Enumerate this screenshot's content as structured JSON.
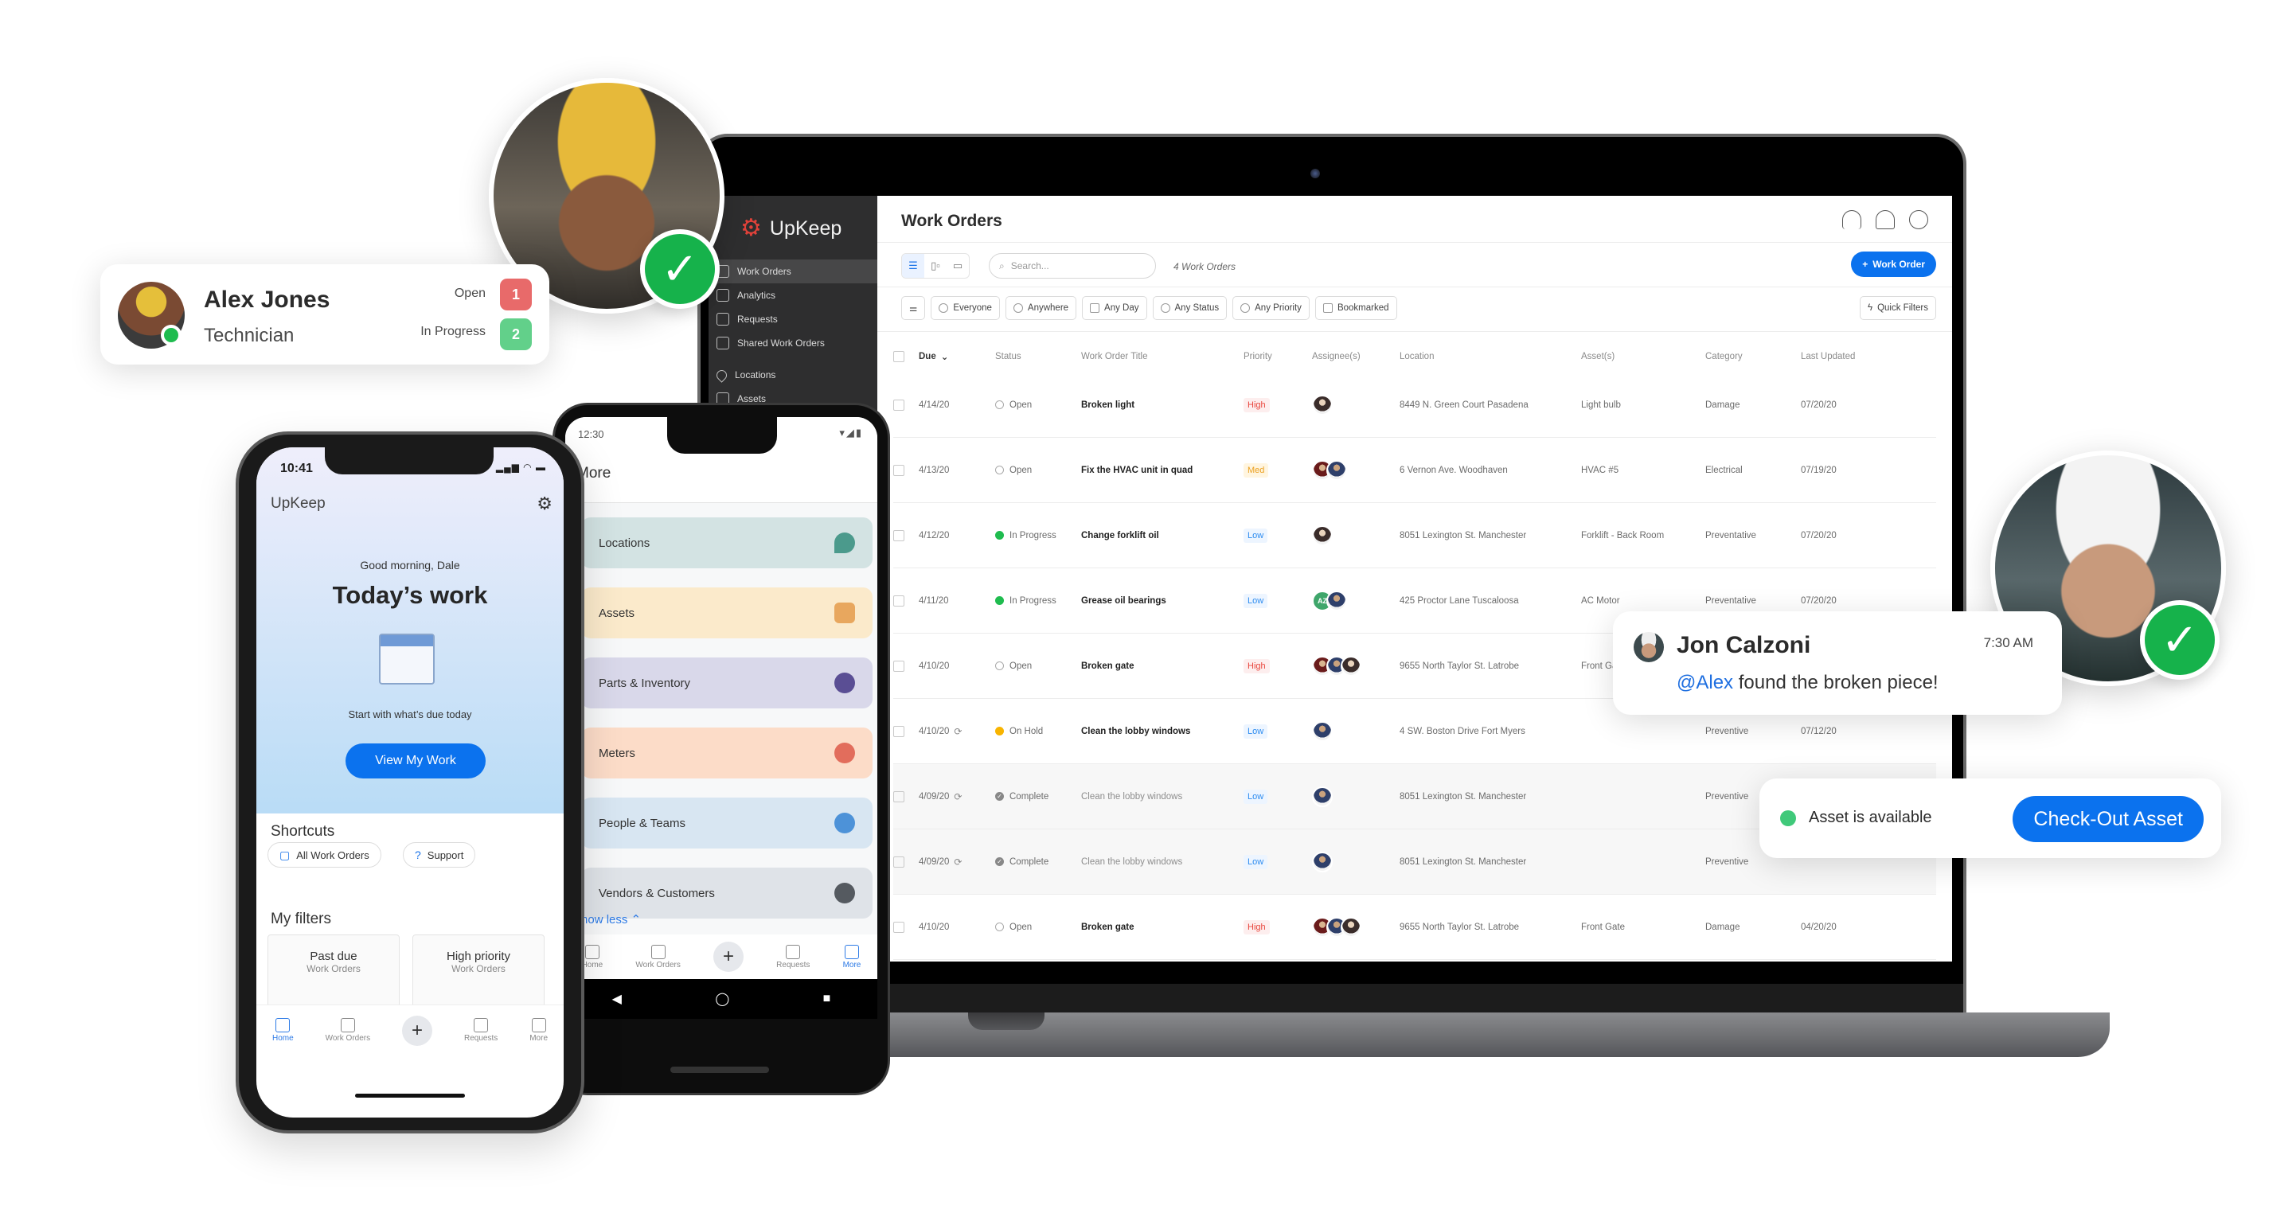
{
  "laptop": {
    "app_name": "UpKeep",
    "sidebar": {
      "items": [
        {
          "label": "Work Orders",
          "icon": "clipboard-icon",
          "active": true
        },
        {
          "label": "Analytics",
          "icon": "chart-icon",
          "active": false
        },
        {
          "label": "Requests",
          "icon": "inbox-icon",
          "active": false
        },
        {
          "label": "Shared Work Orders",
          "icon": "shared-clipboard-icon",
          "active": false
        },
        {
          "label": "Locations",
          "icon": "location-pin-icon",
          "active": false
        },
        {
          "label": "Assets",
          "icon": "cube-icon",
          "active": false
        }
      ]
    },
    "header": {
      "title": "Work Orders",
      "icons": [
        "headset-icon",
        "bell-icon",
        "user-circle-icon"
      ]
    },
    "toolbar": {
      "view_modes": [
        "list-view-icon",
        "board-view-icon",
        "calendar-view-icon"
      ],
      "search_placeholder": "Search...",
      "count_label": "4 Work Orders",
      "add_button": "Work Order",
      "add_icon": "+"
    },
    "filters": [
      {
        "label": "Everyone",
        "icon": "user-icon"
      },
      {
        "label": "Anywhere",
        "icon": "location-icon"
      },
      {
        "label": "Any Day",
        "icon": "calendar-icon"
      },
      {
        "label": "Any Status",
        "icon": "status-icon"
      },
      {
        "label": "Any Priority",
        "icon": "priority-icon"
      },
      {
        "label": "Bookmarked",
        "icon": "bookmark-icon"
      }
    ],
    "quick_filters": "Quick Filters",
    "columns": [
      "Due",
      "Status",
      "Work Order Title",
      "Priority",
      "Assignee(s)",
      "Location",
      "Asset(s)",
      "Category",
      "Last Updated"
    ],
    "rows": [
      {
        "due": "4/14/20",
        "repeat": false,
        "status": "Open",
        "status_kind": "open",
        "title": "Broken light",
        "priority": "High",
        "assignees": [
          "p1"
        ],
        "location": "8449 N. Green Court Pasadena",
        "asset": "Light bulb",
        "category": "Damage",
        "updated": "07/20/20",
        "muted": false
      },
      {
        "due": "4/13/20",
        "repeat": false,
        "status": "Open",
        "status_kind": "open",
        "title": "Fix the HVAC unit in quad",
        "priority": "Med",
        "assignees": [
          "p2",
          "p3"
        ],
        "location": "6 Vernon Ave. Woodhaven",
        "asset": "HVAC #5",
        "category": "Electrical",
        "updated": "07/19/20",
        "muted": false
      },
      {
        "due": "4/12/20",
        "repeat": false,
        "status": "In Progress",
        "status_kind": "prog",
        "title": "Change forklift oil",
        "priority": "Low",
        "assignees": [
          "p1"
        ],
        "location": "8051 Lexington St. Manchester",
        "asset": "Forklift - Back Room",
        "category": "Preventative",
        "updated": "07/20/20",
        "muted": false
      },
      {
        "due": "4/11/20",
        "repeat": false,
        "status": "In Progress",
        "status_kind": "prog",
        "title": "Grease oil bearings",
        "priority": "Low",
        "assignees": [
          "AZ",
          "p3"
        ],
        "location": "425 Proctor Lane Tuscaloosa",
        "asset": "AC Motor",
        "category": "Preventative",
        "updated": "07/20/20",
        "muted": false
      },
      {
        "due": "4/10/20",
        "repeat": false,
        "status": "Open",
        "status_kind": "open",
        "title": "Broken gate",
        "priority": "High",
        "assignees": [
          "p2",
          "p3",
          "p1"
        ],
        "location": "9655 North Taylor St. Latrobe",
        "asset": "Front Gate",
        "category": "",
        "updated": "",
        "muted": false
      },
      {
        "due": "4/10/20",
        "repeat": true,
        "status": "On Hold",
        "status_kind": "hold",
        "title": "Clean the lobby windows",
        "priority": "Low",
        "assignees": [
          "p3"
        ],
        "location": "4 SW. Boston Drive Fort Myers",
        "asset": "",
        "category": "Preventive",
        "updated": "07/12/20",
        "muted": false
      },
      {
        "due": "4/09/20",
        "repeat": true,
        "status": "Complete",
        "status_kind": "done",
        "title": "Clean the lobby windows",
        "priority": "Low",
        "assignees": [
          "p3"
        ],
        "location": "8051 Lexington St. Manchester",
        "asset": "",
        "category": "Preventive",
        "updated": "",
        "muted": true
      },
      {
        "due": "4/09/20",
        "repeat": true,
        "status": "Complete",
        "status_kind": "done",
        "title": "Clean the lobby windows",
        "priority": "Low",
        "assignees": [
          "p3"
        ],
        "location": "8051 Lexington St. Manchester",
        "asset": "",
        "category": "Preventive",
        "updated": "",
        "muted": true
      },
      {
        "due": "4/10/20",
        "repeat": false,
        "status": "Open",
        "status_kind": "open",
        "title": "Broken gate",
        "priority": "High",
        "assignees": [
          "p2",
          "p3",
          "p1"
        ],
        "location": "9655 North Taylor St. Latrobe",
        "asset": "Front Gate",
        "category": "Damage",
        "updated": "04/20/20",
        "muted": false
      }
    ]
  },
  "alex_card": {
    "name": "Alex Jones",
    "role": "Technician",
    "stats": [
      {
        "label": "Open",
        "count": "1",
        "color": "#e86a6a"
      },
      {
        "label": "In Progress",
        "count": "2",
        "color": "#62d08a"
      }
    ]
  },
  "chat_card": {
    "name": "Jon Calzoni",
    "time": "7:30 AM",
    "mention": "@Alex",
    "message": " found the broken piece!"
  },
  "asset_card": {
    "status": "Asset is available",
    "button": "Check-Out Asset"
  },
  "check_mark": "✓",
  "iphone": {
    "time": "10:41",
    "status_icons": "signal wifi battery",
    "logo": "UpKeep",
    "settings_icon": "⚙",
    "greeting": "Good morning, Dale",
    "headline": "Today’s work",
    "subtitle": "Start with what’s due today",
    "cta": "View My Work",
    "shortcuts_title": "Shortcuts",
    "shortcuts": [
      {
        "label": "All Work Orders",
        "icon": "▢"
      },
      {
        "label": "Support",
        "icon": "?"
      }
    ],
    "filters_title": "My filters",
    "filters": [
      {
        "title": "Past due",
        "subtitle": "Work Orders"
      },
      {
        "title": "High priority",
        "subtitle": "Work Orders"
      }
    ],
    "nav": [
      {
        "label": "Home",
        "active": true
      },
      {
        "label": "Work Orders",
        "active": false
      },
      {
        "label": "",
        "plus": true
      },
      {
        "label": "Requests",
        "active": false
      },
      {
        "label": "More",
        "active": false
      }
    ]
  },
  "android": {
    "time": "12:30",
    "status_icons": "▾◢▮",
    "title": "More",
    "items": [
      {
        "label": "Locations",
        "bg": "#d3e3e3",
        "icon_color": "#4b9a8c"
      },
      {
        "label": "Assets",
        "bg": "#fbeacb",
        "icon_color": "#e8a75e"
      },
      {
        "label": "Parts & Inventory",
        "bg": "#d9d8ea",
        "icon_color": "#5a4e94"
      },
      {
        "label": "Meters",
        "bg": "#fcdcc8",
        "icon_color": "#e26d5c"
      },
      {
        "label": "People & Teams",
        "bg": "#d8e6f2",
        "icon_color": "#4d92d8"
      },
      {
        "label": "Vendors & Customers",
        "bg": "#dfe3e8",
        "icon_color": "#555a60"
      }
    ],
    "show_less": "Show less ⌃",
    "nav": [
      {
        "label": "Home",
        "active": false
      },
      {
        "label": "Work Orders",
        "active": false
      },
      {
        "label": "",
        "plus": true
      },
      {
        "label": "Requests",
        "active": false
      },
      {
        "label": "More",
        "active": true
      }
    ],
    "system_nav": [
      "◀",
      "◯",
      "■"
    ]
  }
}
